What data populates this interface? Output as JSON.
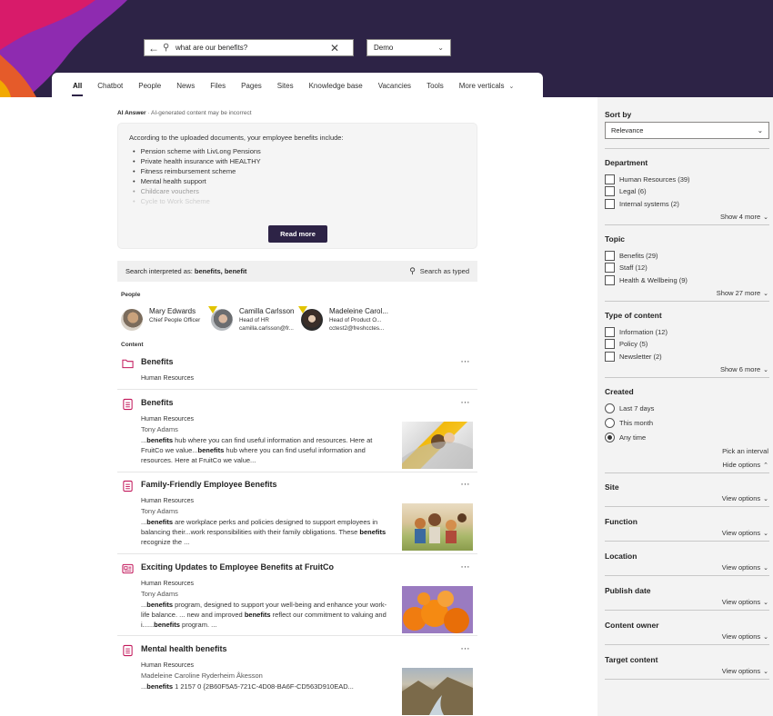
{
  "search": {
    "query": "what are our benefits?",
    "scope": "Demo"
  },
  "tabs": [
    {
      "label": "All"
    },
    {
      "label": "Chatbot"
    },
    {
      "label": "People"
    },
    {
      "label": "News"
    },
    {
      "label": "Files"
    },
    {
      "label": "Pages"
    },
    {
      "label": "Sites"
    },
    {
      "label": "Knowledge base"
    },
    {
      "label": "Vacancies"
    },
    {
      "label": "Tools"
    },
    {
      "label": "More verticals"
    }
  ],
  "ai_answer": {
    "label": "AI Answer",
    "disclaimer": "AI-generated content may be incorrect",
    "intro": "According to the uploaded documents, your employee benefits include:",
    "items": [
      "Pension scheme with LivLong Pensions",
      "Private health insurance with HEALTHY",
      "Fitness reimbursement scheme",
      "Mental health support",
      "Childcare vouchers",
      "Cycle to Work Scheme"
    ],
    "read_more": "Read more"
  },
  "interpreted": {
    "prefix": "Search interpreted as:",
    "terms": "benefits, benefit",
    "search_as_typed": "Search as typed"
  },
  "people": {
    "label": "People",
    "items": [
      {
        "name": "Mary Edwards",
        "line1": "Chief People Officer",
        "line2": ""
      },
      {
        "name": "Camilla Carlsson",
        "line1": "Head of HR",
        "line2": "camilla.carlsson@fr..."
      },
      {
        "name": "Madeleine Carol...",
        "line1": "Head of Product O...",
        "line2": "cctest2@freshcctes..."
      }
    ]
  },
  "content": {
    "label": "Content",
    "results": [
      {
        "title": "Benefits",
        "site": "Human Resources",
        "icon": "folder-icon"
      },
      {
        "title": "Benefits",
        "site": "Human Resources",
        "author": "Tony Adams",
        "icon": "page-icon",
        "s1": "benefits",
        "s2": " hub where you can find useful information and resources. Here at FruitCo we value...",
        "s3": "benefits",
        "s4": " hub where you can find useful information and resources. Here at FruitCo we value..."
      },
      {
        "title": "Family-Friendly Employee Benefits",
        "site": "Human Resources",
        "author": "Tony Adams",
        "icon": "page-icon",
        "s1": "benefits",
        "s2": " are workplace perks and policies designed to support employees in balancing their...work responsibilities with their family obligations. These ",
        "s3": "benefits",
        "s4": " recognize the ..."
      },
      {
        "title": "Exciting Updates to Employee Benefits at FruitCo",
        "site": "Human Resources",
        "author": "Tony Adams",
        "icon": "news-icon",
        "s1": "benefits",
        "s2": " program, designed to support your well-being and enhance your work-life balance. ... new and improved ",
        "s3": "benefits",
        "s4": " reflect our commitment to valuing and i......",
        "s5": "benefits",
        "s6": " program. ..."
      },
      {
        "title": "Mental health benefits",
        "site": "Human Resources",
        "author": "Madeleine Caroline Ryderheim Åkesson",
        "icon": "page-icon",
        "s1": "benefits",
        "s2": " 1 2157 0 {2B60F5A5-721C-4D08-BA6F-CD563D910EAD..."
      }
    ]
  },
  "sidebar": {
    "sort": {
      "title": "Sort by",
      "value": "Relevance"
    },
    "department": {
      "title": "Department",
      "options": [
        "Human Resources (39)",
        "Legal (6)",
        "Internal systems (2)"
      ],
      "more": "Show 4 more"
    },
    "topic": {
      "title": "Topic",
      "options": [
        "Benefits (29)",
        "Staff (12)",
        "Health & Wellbeing (9)"
      ],
      "more": "Show 27 more"
    },
    "type": {
      "title": "Type of content",
      "options": [
        "Information (12)",
        "Policy (5)",
        "Newsletter (2)"
      ],
      "more": "Show 6 more"
    },
    "created": {
      "title": "Created",
      "options": [
        "Last 7 days",
        "This month",
        "Any time"
      ],
      "interval": "Pick an interval",
      "hide": "Hide options"
    },
    "collapsed": [
      {
        "title": "Site",
        "link": "View options"
      },
      {
        "title": "Function",
        "link": "View options"
      },
      {
        "title": "Location",
        "link": "View options"
      },
      {
        "title": "Publish date",
        "link": "View options"
      },
      {
        "title": "Content owner",
        "link": "View options"
      },
      {
        "title": "Target content",
        "link": "View options"
      }
    ]
  },
  "colors": {
    "brand": "#2d2346",
    "accent_pink": "#c2185b",
    "wave_purple": "#9b2fb0"
  }
}
